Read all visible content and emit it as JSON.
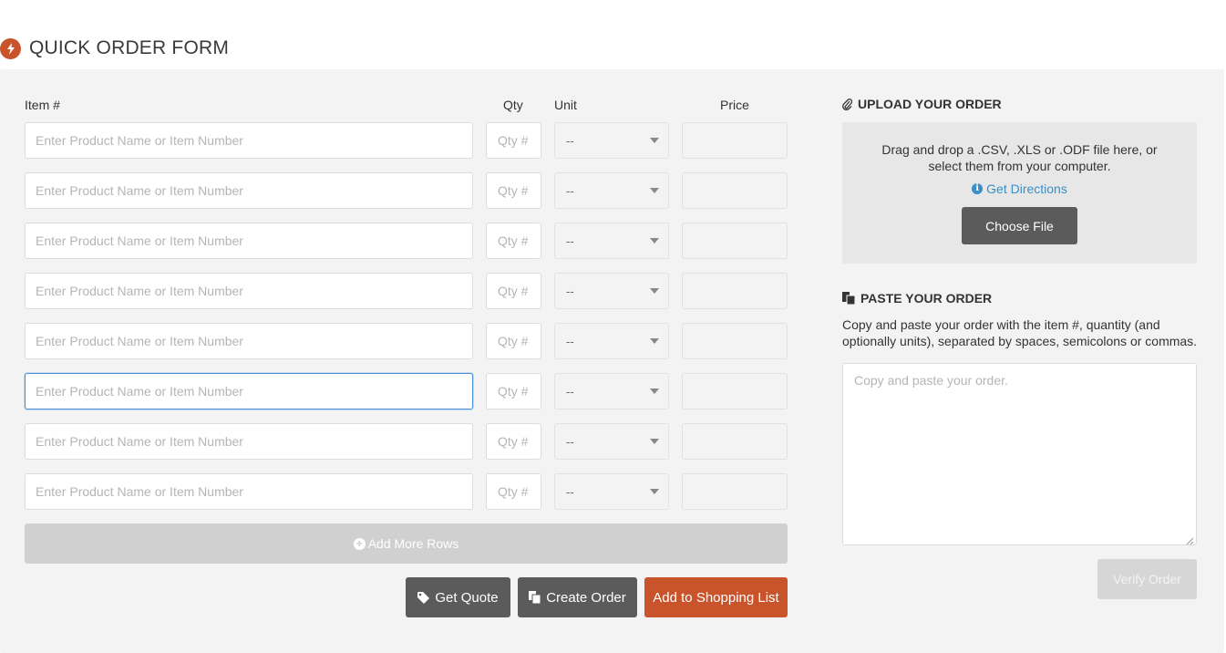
{
  "header": {
    "title": "QUICK ORDER FORM",
    "icon": "lightning-icon",
    "accent": "#c9532a"
  },
  "columns": {
    "item": "Item #",
    "qty": "Qty",
    "unit": "Unit",
    "price": "Price"
  },
  "rows": [
    {
      "item_placeholder": "Enter Product Name or Item Number",
      "qty_placeholder": "Qty #",
      "unit": "--"
    },
    {
      "item_placeholder": "Enter Product Name or Item Number",
      "qty_placeholder": "Qty #",
      "unit": "--"
    },
    {
      "item_placeholder": "Enter Product Name or Item Number",
      "qty_placeholder": "Qty #",
      "unit": "--"
    },
    {
      "item_placeholder": "Enter Product Name or Item Number",
      "qty_placeholder": "Qty #",
      "unit": "--"
    },
    {
      "item_placeholder": "Enter Product Name or Item Number",
      "qty_placeholder": "Qty #",
      "unit": "--"
    },
    {
      "item_placeholder": "Enter Product Name or Item Number",
      "qty_placeholder": "Qty #",
      "unit": "--"
    },
    {
      "item_placeholder": "Enter Product Name or Item Number",
      "qty_placeholder": "Qty #",
      "unit": "--"
    },
    {
      "item_placeholder": "Enter Product Name or Item Number",
      "qty_placeholder": "Qty #",
      "unit": "--"
    }
  ],
  "actions": {
    "add_rows": "Add More Rows",
    "get_quote": "Get Quote",
    "create_order": "Create Order",
    "add_to_list": "Add to Shopping List"
  },
  "upload": {
    "title": "UPLOAD YOUR ORDER",
    "description": "Drag and drop a .CSV, .XLS or .ODF file here, or select them from your computer.",
    "directions_link": "Get Directions",
    "choose_file": "Choose File"
  },
  "paste": {
    "title": "PASTE YOUR ORDER",
    "description": "Copy and paste your order with the item #, quantity (and optionally units), separated by spaces, semicolons or commas.",
    "placeholder": "Copy and paste your order.",
    "verify": "Verify Order"
  }
}
